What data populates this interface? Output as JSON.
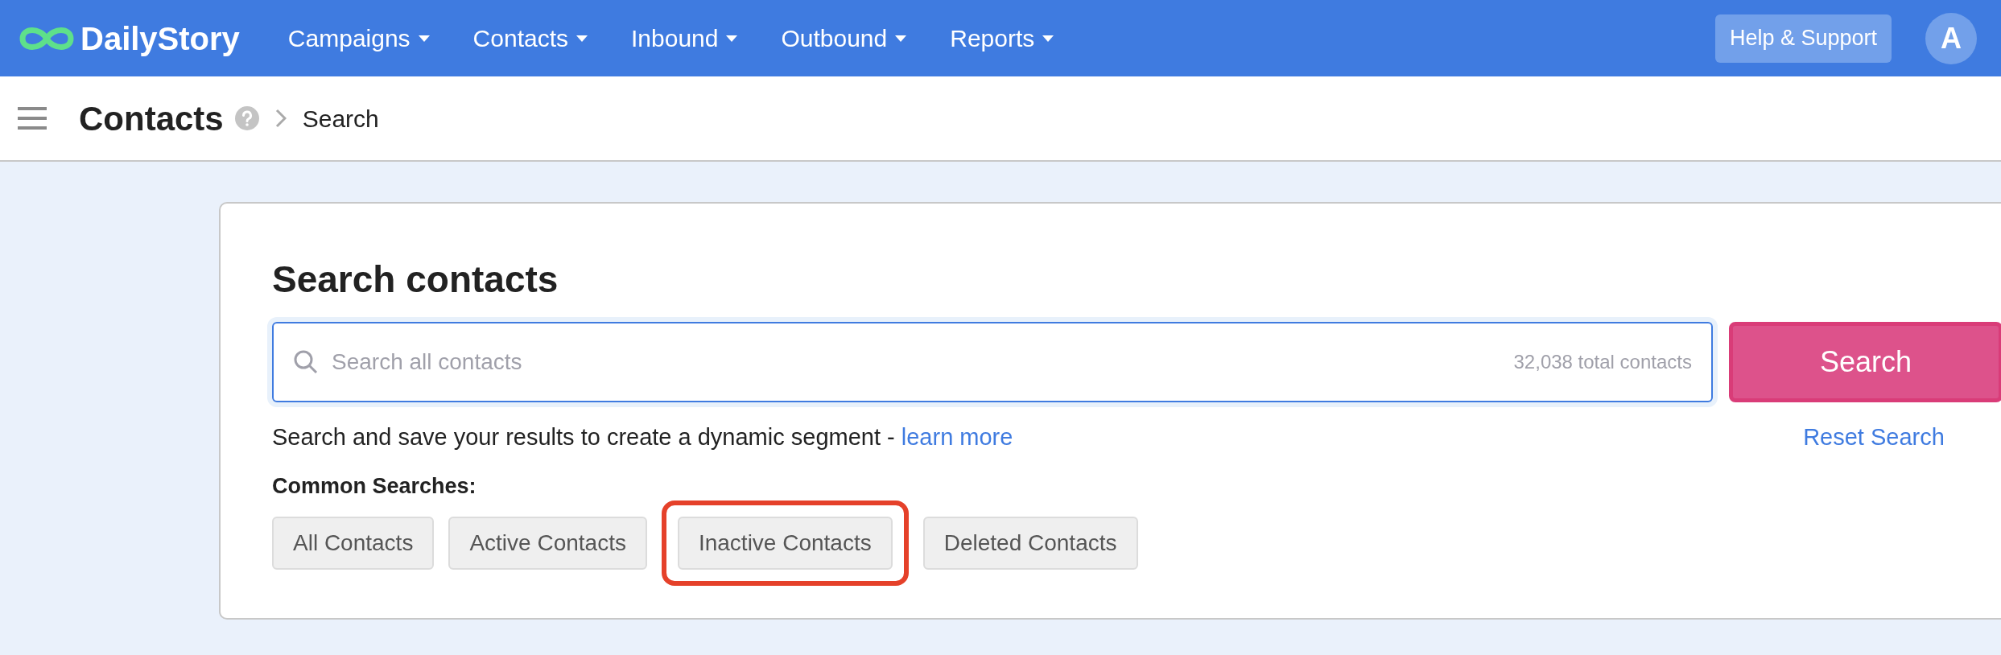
{
  "navbar": {
    "logo": "DailyStory",
    "menu": [
      {
        "label": "Campaigns"
      },
      {
        "label": "Contacts"
      },
      {
        "label": "Inbound"
      },
      {
        "label": "Outbound"
      },
      {
        "label": "Reports"
      }
    ],
    "help_button": "Help & Support",
    "avatar": "A"
  },
  "breadcrumb": {
    "title": "Contacts",
    "current": "Search"
  },
  "search_card": {
    "title": "Search contacts",
    "search": {
      "placeholder": "Search all contacts",
      "count": "32,038 total contacts"
    },
    "search_button": "Search",
    "description": "Search and save your results to create a dynamic segment - ",
    "learn_more": "learn more",
    "reset": "Reset Search",
    "common_label": "Common Searches:",
    "common_searches": [
      {
        "label": "All Contacts",
        "highlighted": false
      },
      {
        "label": "Active Contacts",
        "highlighted": false
      },
      {
        "label": "Inactive Contacts",
        "highlighted": true
      },
      {
        "label": "Deleted Contacts",
        "highlighted": false
      }
    ]
  }
}
